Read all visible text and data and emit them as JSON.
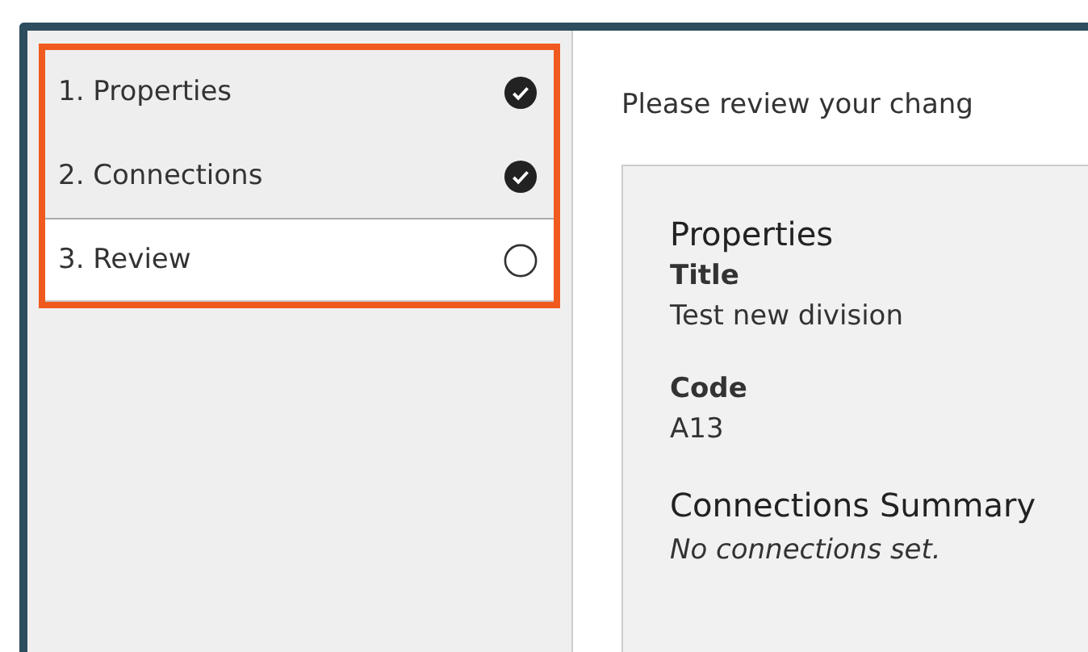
{
  "steps": [
    {
      "label": "1. Properties",
      "completed": true,
      "selected": false
    },
    {
      "label": "2. Connections",
      "completed": true,
      "selected": false
    },
    {
      "label": "3. Review",
      "completed": false,
      "selected": true
    }
  ],
  "intro": "Please review your chang",
  "summary": {
    "sections": [
      {
        "kind": "heading",
        "text": "Properties"
      },
      {
        "kind": "field",
        "label": "Title",
        "value": "Test new division"
      },
      {
        "kind": "field",
        "label": "Code",
        "value": "A13"
      },
      {
        "kind": "heading",
        "text": "Connections Summary"
      },
      {
        "kind": "note",
        "text": "No connections set."
      }
    ]
  }
}
